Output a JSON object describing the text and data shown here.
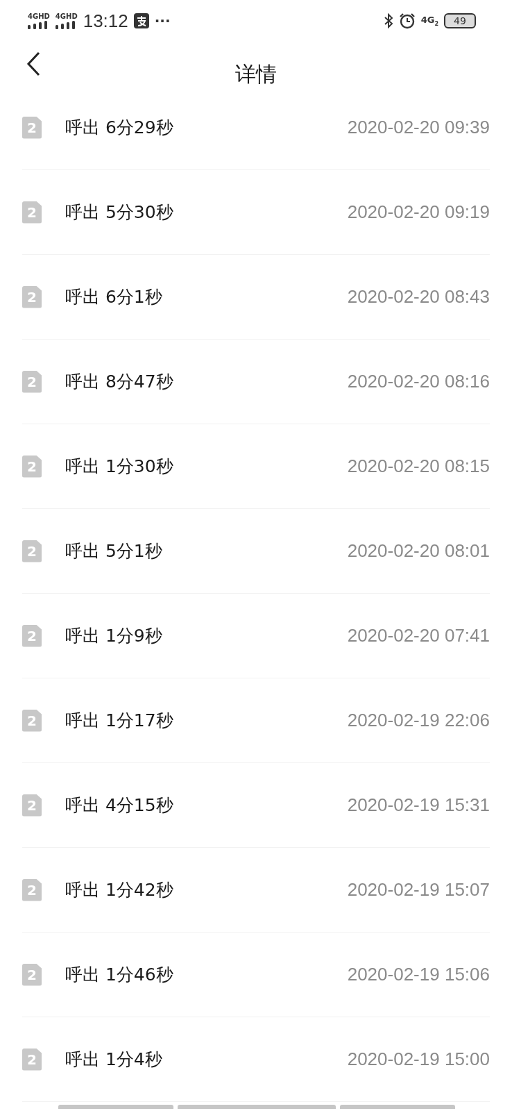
{
  "status_bar": {
    "signal_labels": [
      "4GHD",
      "4GHD"
    ],
    "time": "13:12",
    "more": "···",
    "network": "4G",
    "network_sim": "2",
    "battery": "49"
  },
  "header": {
    "title": "详情"
  },
  "calls": [
    {
      "sim": "2",
      "type": "呼出",
      "duration": "6分29秒",
      "datetime": "2020-02-20 09:39"
    },
    {
      "sim": "2",
      "type": "呼出",
      "duration": "5分30秒",
      "datetime": "2020-02-20 09:19"
    },
    {
      "sim": "2",
      "type": "呼出",
      "duration": "6分1秒",
      "datetime": "2020-02-20 08:43"
    },
    {
      "sim": "2",
      "type": "呼出",
      "duration": "8分47秒",
      "datetime": "2020-02-20 08:16"
    },
    {
      "sim": "2",
      "type": "呼出",
      "duration": "1分30秒",
      "datetime": "2020-02-20 08:15"
    },
    {
      "sim": "2",
      "type": "呼出",
      "duration": "5分1秒",
      "datetime": "2020-02-20 08:01"
    },
    {
      "sim": "2",
      "type": "呼出",
      "duration": "1分9秒",
      "datetime": "2020-02-20 07:41"
    },
    {
      "sim": "2",
      "type": "呼出",
      "duration": "1分17秒",
      "datetime": "2020-02-19 22:06"
    },
    {
      "sim": "2",
      "type": "呼出",
      "duration": "4分15秒",
      "datetime": "2020-02-19 15:31"
    },
    {
      "sim": "2",
      "type": "呼出",
      "duration": "1分42秒",
      "datetime": "2020-02-19 15:07"
    },
    {
      "sim": "2",
      "type": "呼出",
      "duration": "1分46秒",
      "datetime": "2020-02-19 15:06"
    },
    {
      "sim": "2",
      "type": "呼出",
      "duration": "1分4秒",
      "datetime": "2020-02-19 15:00"
    }
  ]
}
